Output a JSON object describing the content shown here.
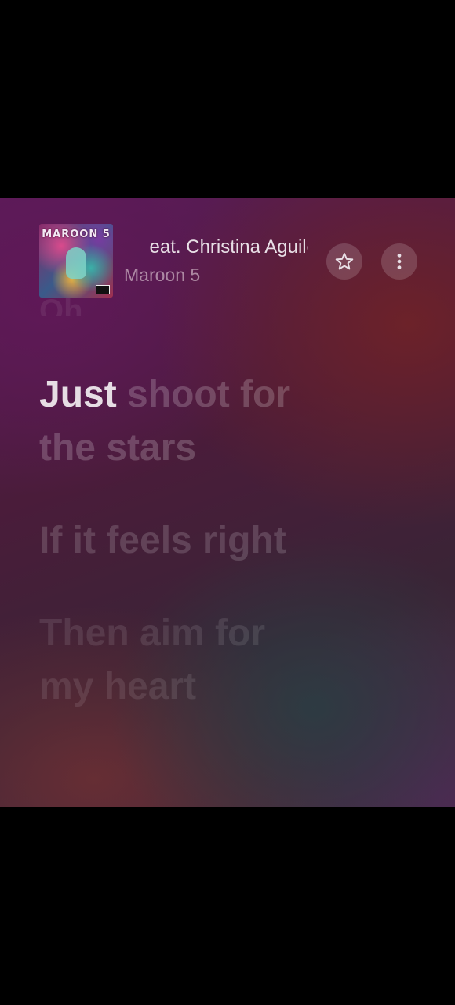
{
  "now_playing": {
    "title": "Moves Like Jagger (feat. Christina Aguilera)",
    "title_visible": "eat. Christina Aguile",
    "artist": "Maroon 5",
    "album_art_text": "MAROON 5"
  },
  "controls": {
    "favorite_icon": "star-outline-icon",
    "more_icon": "more-vertical-icon"
  },
  "lyrics": {
    "previous_partial": "Oh",
    "current_line": {
      "sung": "Just",
      "upcoming": "shoot for",
      "second_row": "the stars"
    },
    "next_lines": [
      {
        "row1": "If it feels right",
        "row2": ""
      },
      {
        "row1": "Then aim for",
        "row2": "my heart"
      }
    ]
  },
  "colors": {
    "active_lyric": "#e6dde4",
    "background_primary": "#5a1c5a",
    "background_secondary": "#6e2228"
  }
}
